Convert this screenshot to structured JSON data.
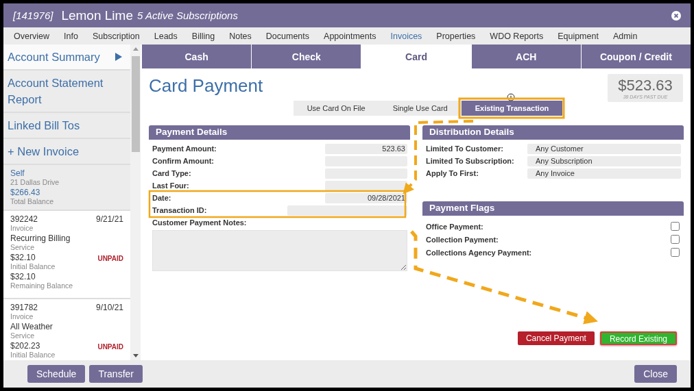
{
  "window": {
    "id": "[141976]",
    "title": "Lemon Lime",
    "subtitle": "5 Active Subscriptions"
  },
  "nav": [
    {
      "label": "Overview",
      "selected": false
    },
    {
      "label": "Info",
      "selected": false
    },
    {
      "label": "Subscription",
      "selected": false
    },
    {
      "label": "Leads",
      "selected": false
    },
    {
      "label": "Billing",
      "selected": false
    },
    {
      "label": "Notes",
      "selected": false
    },
    {
      "label": "Documents",
      "selected": false
    },
    {
      "label": "Appointments",
      "selected": false
    },
    {
      "label": "Invoices",
      "selected": true
    },
    {
      "label": "Properties",
      "selected": false
    },
    {
      "label": "WDO Reports",
      "selected": false
    },
    {
      "label": "Equipment",
      "selected": false
    },
    {
      "label": "Admin",
      "selected": false
    }
  ],
  "sidebar": {
    "links": [
      {
        "label": "Account Summary",
        "selected": true
      },
      {
        "label": "Account Statement Report",
        "selected": false
      },
      {
        "label": "Linked Bill Tos",
        "selected": false
      },
      {
        "label": "+ New Invoice",
        "selected": false
      }
    ],
    "account": {
      "name": "Self",
      "address": "21 Dallas Drive",
      "balance": "$266.43",
      "balance_label": "Total Balance"
    },
    "invoices": [
      {
        "number": "392242",
        "type": "Invoice",
        "date": "9/21/21",
        "name": "Recurring Billing",
        "category": "Service",
        "status": "UNPAID",
        "amounts": [
          {
            "value": "$32.10",
            "label": "Initial Balance"
          },
          {
            "value": "$32.10",
            "label": "Remaining Balance"
          }
        ]
      },
      {
        "number": "391782",
        "type": "Invoice",
        "date": "9/10/21",
        "name": "All Weather",
        "category": "Service",
        "status": "UNPAID",
        "amounts": [
          {
            "value": "$202.23",
            "label": "Initial Balance"
          }
        ]
      }
    ]
  },
  "payment_tabs": [
    {
      "label": "Cash",
      "selected": false
    },
    {
      "label": "Check",
      "selected": false
    },
    {
      "label": "Card",
      "selected": true
    },
    {
      "label": "ACH",
      "selected": false
    },
    {
      "label": "Coupon / Credit",
      "selected": false
    }
  ],
  "page_title": "Card Payment",
  "balance": {
    "amount": "$523.63",
    "note": "38 DAYS PAST DUE"
  },
  "modes": [
    {
      "label": "Use Card On File",
      "selected": false
    },
    {
      "label": "Single Use Card",
      "selected": false
    },
    {
      "label": "Existing Transaction",
      "selected": true
    }
  ],
  "payment_details": {
    "title": "Payment Details",
    "fields": [
      {
        "label": "Payment Amount:",
        "value": "523.63"
      },
      {
        "label": "Confirm Amount:"
      },
      {
        "label": "Card Type:"
      },
      {
        "label": "Last Four:"
      },
      {
        "label": "Date:",
        "value": "09/28/2021"
      },
      {
        "label": "Transaction ID:"
      }
    ],
    "notes_label": "Customer Payment Notes:"
  },
  "distribution": {
    "title": "Distribution Details",
    "fields": [
      {
        "label": "Limited To Customer:",
        "value": "Any Customer"
      },
      {
        "label": "Limited To Subscription:",
        "value": "Any Subscription"
      },
      {
        "label": "Apply To First:",
        "value": "Any Invoice"
      }
    ]
  },
  "flags": {
    "title": "Payment Flags",
    "items": [
      {
        "label": "Office Payment:",
        "checked": false
      },
      {
        "label": "Collection Payment:",
        "checked": false
      },
      {
        "label": "Collections Agency Payment:",
        "checked": false
      }
    ]
  },
  "actions": [
    {
      "label": "Cancel Payment",
      "kind": "cancel"
    },
    {
      "label": "Record Existing",
      "kind": "record"
    }
  ],
  "footer": {
    "left": [
      "Schedule",
      "Transfer"
    ],
    "right": [
      "Close"
    ]
  }
}
